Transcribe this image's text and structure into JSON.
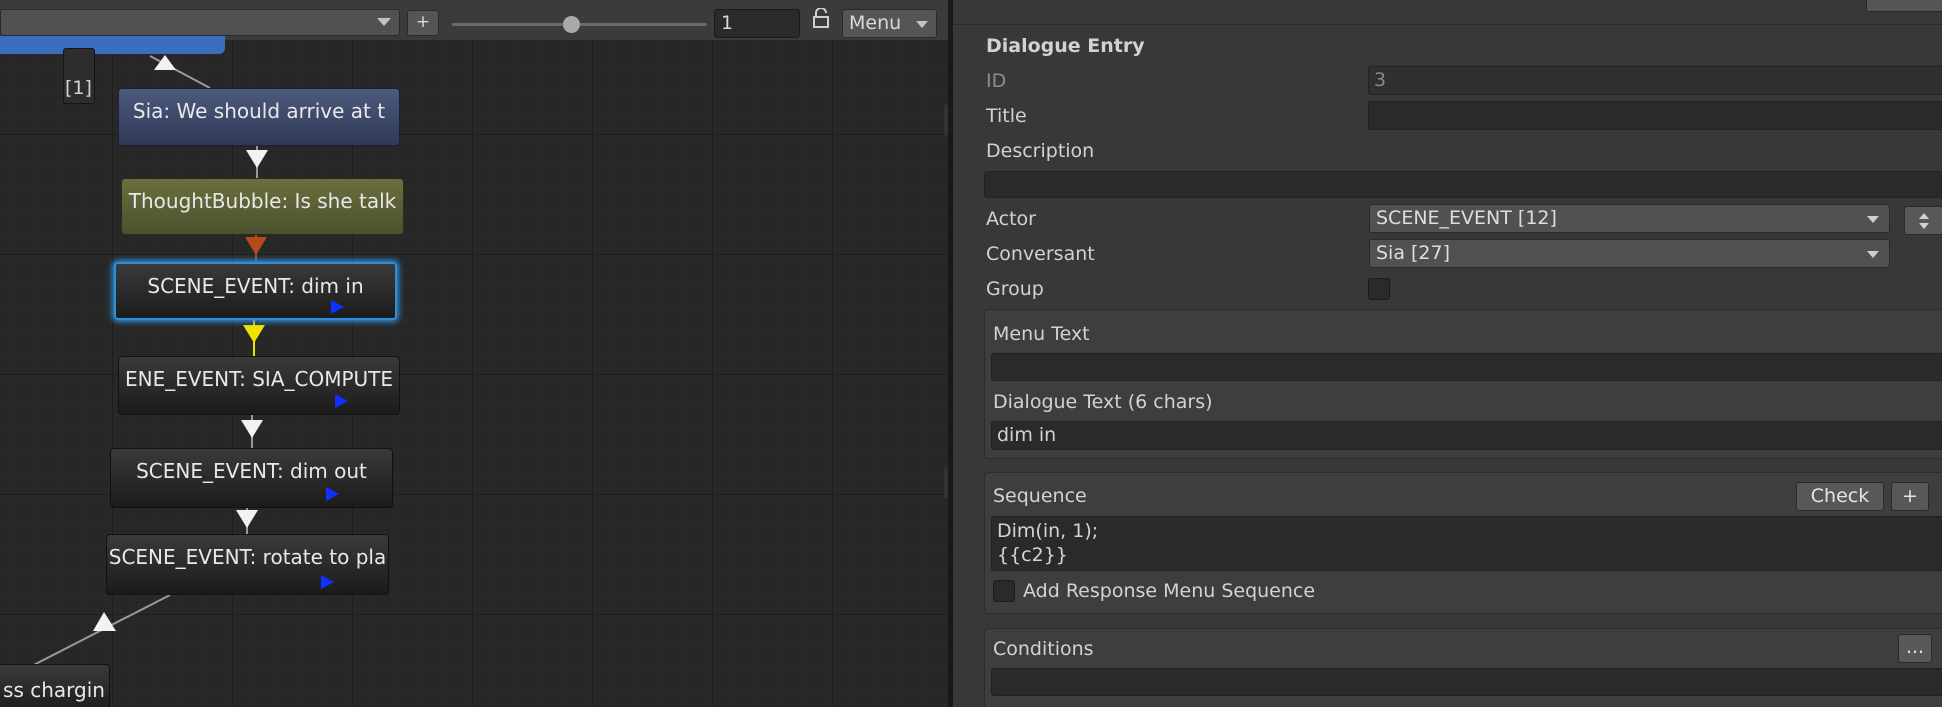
{
  "toolbar": {
    "add_label": "+",
    "zoom_value": "1",
    "menu_label": "Menu"
  },
  "graph": {
    "link_tag": "[1]",
    "nodes": [
      {
        "label": "Sia: We should arrive at t"
      },
      {
        "label": "ThoughtBubble: Is she talk"
      },
      {
        "label": "SCENE_EVENT: dim in"
      },
      {
        "label": "ENE_EVENT: SIA_COMPUTE"
      },
      {
        "label": "SCENE_EVENT: dim out"
      },
      {
        "label": "SCENE_EVENT: rotate to pla"
      },
      {
        "label": "ss chargin"
      }
    ]
  },
  "inspector": {
    "section_title": "Dialogue Entry",
    "id_label": "ID",
    "id_value": "3",
    "title_label": "Title",
    "title_value": "",
    "description_label": "Description",
    "description_value": "",
    "actor_label": "Actor",
    "actor_value": "SCENE_EVENT [12]",
    "conversant_label": "Conversant",
    "conversant_value": "Sia [27]",
    "group_label": "Group",
    "menu_text_label": "Menu Text",
    "menu_text_value": "",
    "dialogue_text_label": "Dialogue Text (6 chars)",
    "dialogue_text_value": "dim in",
    "sequence_label": "Sequence",
    "check_label": "Check",
    "sequence_add_label": "+",
    "sequence_line1": "Dim(in, 1);",
    "sequence_line2": "{{c2}}",
    "add_response_label": "Add Response Menu Sequence",
    "conditions_label": "Conditions",
    "conditions_more_label": "...",
    "conditions_value": ""
  },
  "colors": {
    "selected_glow": "#2f8ed8",
    "play_arrow": "#1030ff",
    "yellow_arrow": "#f2e200",
    "orange_arrow": "#b54a1c"
  }
}
